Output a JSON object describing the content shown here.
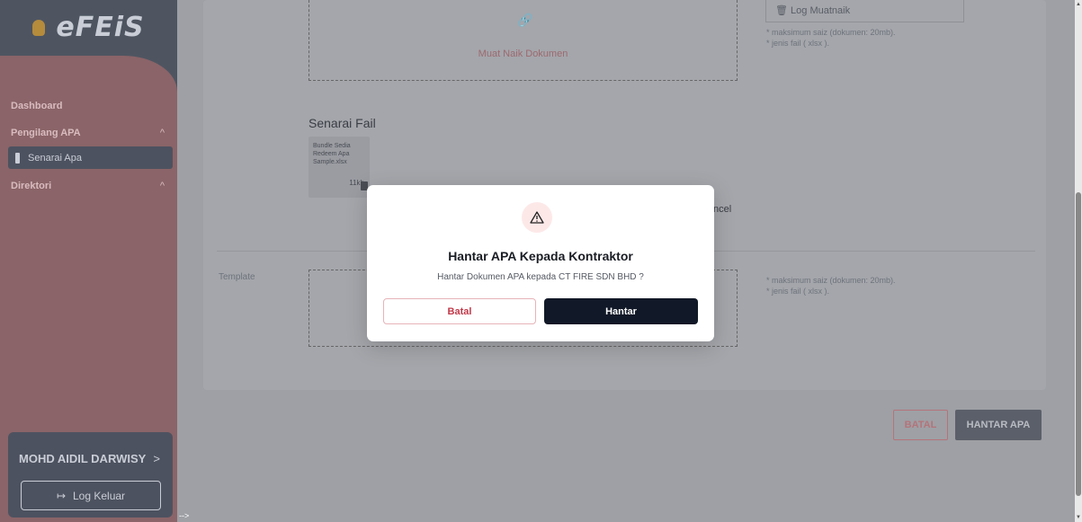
{
  "app": {
    "logo_text": "eFEiS"
  },
  "sidebar": {
    "items": [
      {
        "label": "Dashboard"
      },
      {
        "label": "Pengilang APA",
        "chevron": "^"
      },
      {
        "label": "Senarai Apa",
        "icon": "file-icon"
      },
      {
        "label": "Direktori",
        "chevron": "^"
      }
    ],
    "user": {
      "name": "MOHD AIDIL DARWISY",
      "chevron": ">"
    },
    "logout_label": "Log Keluar",
    "arrow_note": "-->"
  },
  "upload": {
    "label": "Muat Naik Dokumen",
    "log_label": "Log Muatnaik",
    "hint1": "* maksimum saiz (dokumen: 20mb).",
    "hint2": "* jenis fail ( xlsx )."
  },
  "files": {
    "title": "Senarai Fail",
    "items": [
      {
        "name": "Bundle Sedia Redeem Apa Sample.xlsx",
        "size": "11kb"
      }
    ]
  },
  "background_cancel_fragment": "ncel",
  "template_section": {
    "label": "Template",
    "hint1": "* maksimum saiz (dokumen: 20mb).",
    "hint2": "* jenis fail ( xlsx )."
  },
  "actions": {
    "batal": "BATAL",
    "hantar": "HANTAR APA"
  },
  "modal": {
    "title": "Hantar APA Kepada Kontraktor",
    "message": "Hantar Dokumen APA kepada CT FIRE SDN BHD ?",
    "cancel_label": "Batal",
    "confirm_label": "Hantar"
  },
  "colors": {
    "accent": "#c23a4a",
    "dark": "#111827",
    "sidebar_bg": "#4e5561",
    "sidebar_menu_bg": "#8a6468"
  }
}
